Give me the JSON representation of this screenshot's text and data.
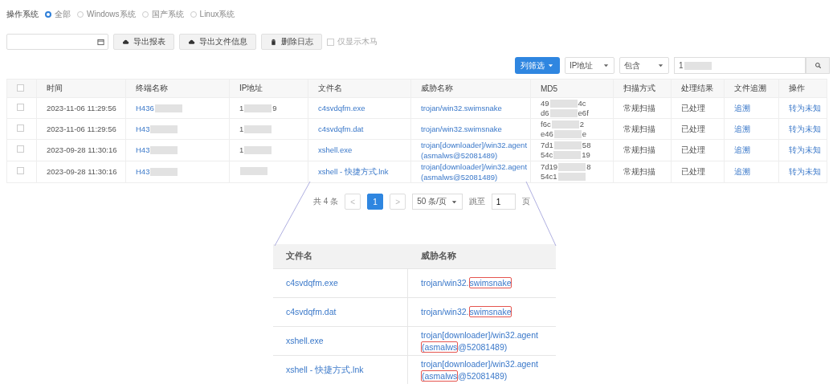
{
  "os_filter": {
    "label": "操作系统",
    "options": [
      {
        "label": "全部",
        "selected": true
      },
      {
        "label": "Windows系统",
        "selected": false
      },
      {
        "label": "国产系统",
        "selected": false
      },
      {
        "label": "Linux系统",
        "selected": false
      }
    ]
  },
  "toolbar": {
    "buttons": [
      {
        "label": "导出报表",
        "kind": "export"
      },
      {
        "label": "导出文件信息",
        "kind": "export"
      },
      {
        "label": "删除日志",
        "kind": "delete"
      }
    ],
    "checkbox": {
      "label": "仅显示木马",
      "checked": false
    }
  },
  "filter_bar": {
    "column_filter": "列筛选",
    "field_select": "IP地址",
    "operator_select": "包含",
    "search_value": "1"
  },
  "table": {
    "select_all_checked": false,
    "columns": [
      "时间",
      "终端名称",
      "IP地址",
      "文件名",
      "威胁名称",
      "MD5",
      "扫描方式",
      "处理结果",
      "文件追溯",
      "操作"
    ],
    "rows": [
      {
        "checked": false,
        "time": "2023-11-06 11:29:56",
        "terminal": {
          "prefix": "H436"
        },
        "ip": {
          "prefix": "1",
          "suffix": "9"
        },
        "file": "c4svdqfm.exe",
        "threat": "trojan/win32.swimsnake",
        "md5": [
          {
            "prefix": "49",
            "suffix": "4c"
          },
          {
            "prefix": "d6",
            "suffix": "e6f"
          }
        ],
        "scan": "常规扫描",
        "result": "已处理",
        "trace": "追溯",
        "action": "转为未知"
      },
      {
        "checked": false,
        "time": "2023-11-06 11:29:56",
        "terminal": {
          "prefix": "H43"
        },
        "ip": {
          "prefix": "1"
        },
        "file": "c4svdqfm.dat",
        "threat": "trojan/win32.swimsnake",
        "md5": [
          {
            "prefix": "f6c",
            "suffix": "2"
          },
          {
            "prefix": "e46",
            "suffix": "e"
          }
        ],
        "scan": "常规扫描",
        "result": "已处理",
        "trace": "追溯",
        "action": "转为未知"
      },
      {
        "checked": false,
        "time": "2023-09-28 11:30:16",
        "terminal": {
          "prefix": "H43"
        },
        "ip": {
          "prefix": "1"
        },
        "file": "xshell.exe",
        "threat": "trojan[downloader]/win32.agent (asmalws@52081489)",
        "md5": [
          {
            "prefix": "7d1",
            "suffix": "58"
          },
          {
            "prefix": "54c",
            "suffix": "19"
          }
        ],
        "scan": "常规扫描",
        "result": "已处理",
        "trace": "追溯",
        "action": "转为未知"
      },
      {
        "checked": false,
        "time": "2023-09-28 11:30:16",
        "terminal": {
          "prefix": "H43"
        },
        "ip": {},
        "file": "xshell - 快捷方式.lnk",
        "threat": "trojan[downloader]/win32.agent (asmalws@52081489)",
        "md5": [
          {
            "prefix": "7d19",
            "suffix": "8"
          },
          {
            "prefix": "54c1"
          }
        ],
        "scan": "常规扫描",
        "result": "已处理",
        "trace": "追溯",
        "action": "转为未知"
      }
    ]
  },
  "pagination": {
    "total": "共 4 条",
    "prev": "<",
    "pages": [
      {
        "label": "1",
        "selected": true
      }
    ],
    "next": ">",
    "page_size": "50 条/页",
    "goto_label": "跳至",
    "goto_value": "1",
    "page_unit": "页"
  },
  "callout": {
    "columns": [
      "文件名",
      "威胁名称"
    ],
    "rows": [
      {
        "file": "c4svdqfm.exe",
        "threat": [
          {
            "text": "trojan/win32.",
            "marked": false
          },
          {
            "text": "swimsnake",
            "marked": true
          }
        ]
      },
      {
        "file": "c4svdqfm.dat",
        "threat": [
          {
            "text": "trojan/win32.",
            "marked": false
          },
          {
            "text": "swimsnake",
            "marked": true
          }
        ]
      },
      {
        "file": "xshell.exe",
        "threat": [
          {
            "text": "trojan[downloader]/win32.agent ",
            "marked": false
          },
          {
            "text": "(asmalws",
            "marked": true
          },
          {
            "text": "@52081489)",
            "marked": false
          }
        ]
      },
      {
        "file": "xshell - 快捷方式.lnk",
        "threat": [
          {
            "text": "trojan[downloader]/win32.agent ",
            "marked": false
          },
          {
            "text": "(asmalws",
            "marked": true
          },
          {
            "text": "@52081489)",
            "marked": false
          }
        ]
      }
    ]
  }
}
